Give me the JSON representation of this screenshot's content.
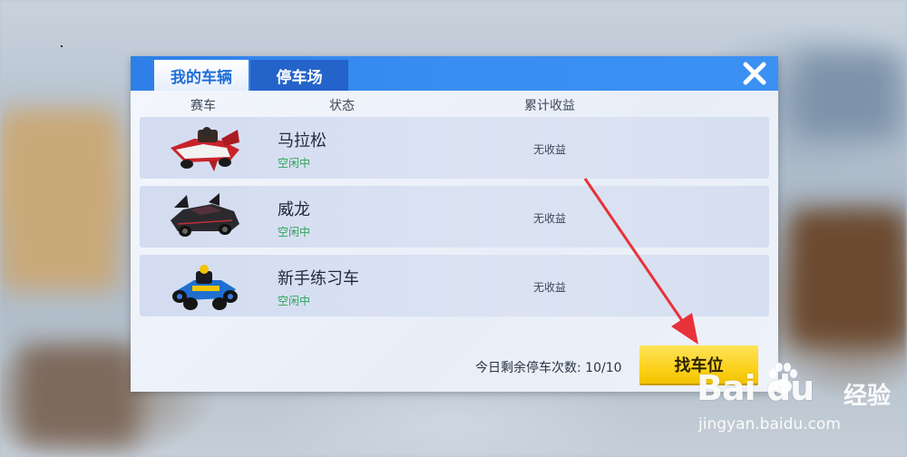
{
  "tabs": [
    {
      "label": "我的车辆",
      "active": true
    },
    {
      "label": "停车场",
      "active": false
    }
  ],
  "columns": {
    "car": "赛车",
    "status": "状态",
    "earnings": "累计收益"
  },
  "cars": [
    {
      "name": "马拉松",
      "status": "空闲中",
      "earnings": "无收益"
    },
    {
      "name": "威龙",
      "status": "空闲中",
      "earnings": "无收益"
    },
    {
      "name": "新手练习车",
      "status": "空闲中",
      "earnings": "无收益"
    }
  ],
  "footer": {
    "remaining_parking": "今日剩余停车次数: 10/10",
    "find_button": "找车位"
  },
  "watermark": {
    "logo": "Bai du",
    "cn": "经验",
    "url": "jingyan.baidu.com"
  },
  "colors": {
    "header": "#3a8ef2",
    "active_tab_text": "#1f6fd9",
    "status_green": "#2fa35a",
    "find_button": "#fcd21c",
    "arrow": "#e8323a"
  },
  "icons": {
    "close": "close-icon",
    "cars": [
      "red-race-car",
      "black-sports-car",
      "blue-go-kart"
    ]
  }
}
